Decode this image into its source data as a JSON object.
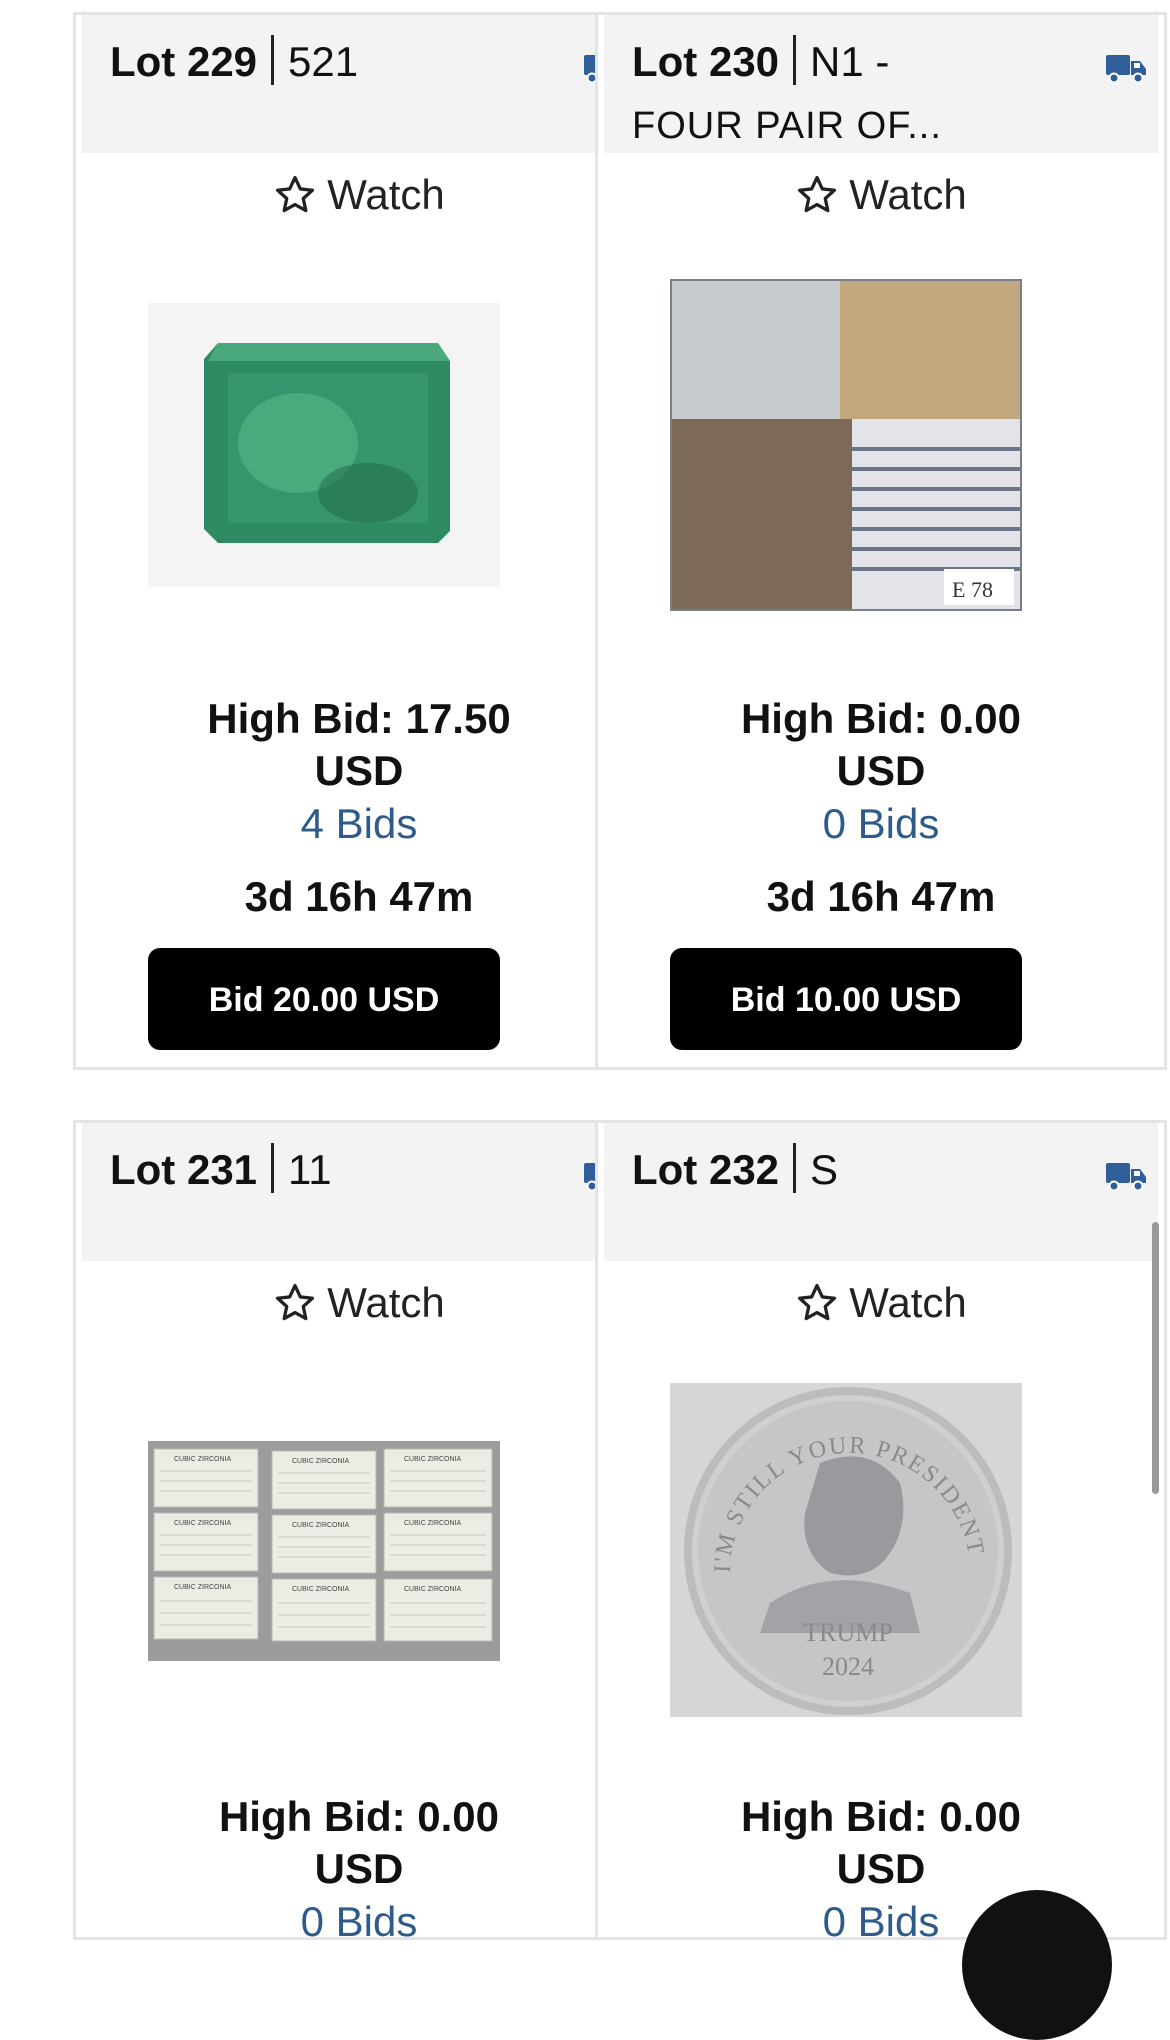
{
  "colors": {
    "accent_link": "#2e5b8a",
    "bid_button": "#000000",
    "truck_icon": "#2f5f9a"
  },
  "lots": [
    {
      "lot": "Lot 229",
      "sub": "521",
      "title_line2": "",
      "watch": "Watch",
      "image_icon": "emerald-gemstone-photo",
      "high_bid": "High Bid: 17.50",
      "currency": "USD",
      "bids": "4 Bids",
      "time_left": "3d 16h 47m",
      "bid_button": "Bid 20.00 USD"
    },
    {
      "lot": "Lot 230",
      "sub": "N1 -",
      "title_line2": "FOUR PAIR OF...",
      "watch": "Watch",
      "image_icon": "four-pants-photo",
      "photo_tag": "E 78",
      "high_bid": "High Bid: 0.00",
      "currency": "USD",
      "bids": "0 Bids",
      "time_left": "3d 16h 47m",
      "bid_button": "Bid 10.00 USD"
    },
    {
      "lot": "Lot 231",
      "sub": "11",
      "title_line2": "",
      "watch": "Watch",
      "image_icon": "cubic-zirconia-cards-photo",
      "photo_card_text": "CUBIC ZIRCONIA",
      "high_bid": "High Bid: 0.00",
      "currency": "USD",
      "bids": "0 Bids"
    },
    {
      "lot": "Lot 232",
      "sub": "S",
      "title_line2": "",
      "watch": "Watch",
      "image_icon": "silver-coin-photo",
      "coin_text": "I'M STILL YOUR PRESIDENT",
      "coin_name": "TRUMP",
      "coin_year": "2024",
      "high_bid": "High Bid: 0.00",
      "currency": "USD",
      "bids": "0 Bids"
    }
  ]
}
